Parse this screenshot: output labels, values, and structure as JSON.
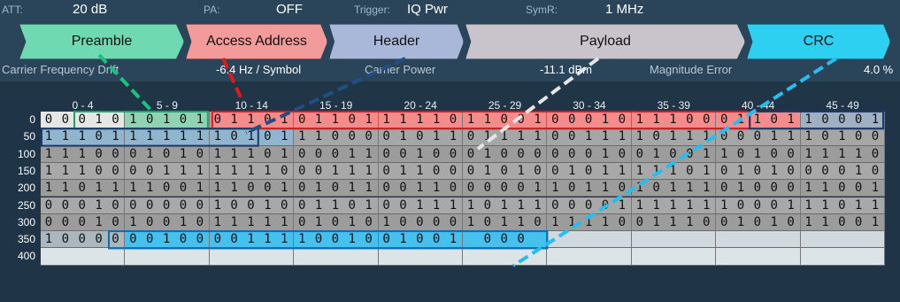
{
  "status_bar": {
    "att_label": "ATT:",
    "att_value": "20 dB",
    "pa_label": "PA:",
    "pa_value": "OFF",
    "trigger_label": "Trigger:",
    "trigger_value": "IQ Pwr",
    "symr_label": "SymR:",
    "symr_value": "1 MHz"
  },
  "fields": [
    {
      "label": "Preamble",
      "color": "#6fd9b2"
    },
    {
      "label": "Access Address",
      "color": "#f39a9a"
    },
    {
      "label": "Header",
      "color": "#a9b8d9"
    },
    {
      "label": "Payload",
      "color": "#c9c3cc"
    },
    {
      "label": "CRC",
      "color": "#2ed0f2"
    }
  ],
  "measurements": {
    "cfd_label": "Carrier Frequency Drift",
    "cfd_value": "-6.4 Hz / Symbol",
    "cp_label": "Carrier Power",
    "cp_value": "-11.1 dBm",
    "me_label": "Magnitude Error",
    "me_value": "4.0 %"
  },
  "column_headers": [
    "0 - 4",
    "5 - 9",
    "10 - 14",
    "15 - 19",
    "20 - 24",
    "25 - 29",
    "30 - 34",
    "35 - 39",
    "40 - 44",
    "45 - 49"
  ],
  "row_labels": [
    "0",
    "50",
    "100",
    "150",
    "200",
    "250",
    "300",
    "350",
    "400"
  ],
  "bit_rows": [
    [
      "0 0 0 1 0",
      "1 0 1 0 1",
      "0 1 1 0 1",
      "0 1 1 0 1",
      "1 1 1 1 0",
      "1 1 0 0 1",
      "0 0 0 1 0",
      "1 1 1 0 0",
      "0 1 1 0 1",
      "1 0 0 0 1"
    ],
    [
      "1 1 1 0 1",
      "1 1 1 1 1",
      "1 0 1 0 1",
      "1 1 0 0 0",
      "0 1 0 1 1",
      "0 1 1 1 1",
      "0 0 1 1 1",
      "1 0 1 1 1",
      "0 0 0 1 1",
      "1 0 1 0 0"
    ],
    [
      "1 1 1 0 0",
      "0 1 0 1 0",
      "1 1 1 0 1",
      "0 0 0 1 1",
      "0 0 1 0 0",
      "0 1 0 0 0",
      "0 0 0 1 0",
      "0 1 0 0 1",
      "1 0 1 0 0",
      "1 1 1 1 0"
    ],
    [
      "1 1 1 0 0",
      "0 0 1 1 1",
      "1 1 1 1 0",
      "0 0 1 1 1",
      "0 1 1 0 0",
      "0 1 0 1 0",
      "0 1 0 1 1",
      "1 1 1 0 1",
      "0 1 0 1 0",
      "0 0 0 1 0"
    ],
    [
      "1 1 0 1 1",
      "1 1 0 0 1",
      "1 1 0 0 1",
      "0 1 0 1 1",
      "0 0 1 1 0",
      "0 0 0 0 1",
      "1 0 1 1 0",
      "1 0 1 1 1",
      "0 1 0 0 0",
      "1 1 0 0 1"
    ],
    [
      "0 0 0 1 0",
      "0 0 0 0 0",
      "1 0 0 1 0",
      "0 1 1 0 1",
      "0 0 1 1 1",
      "1 0 1 1 1",
      "0 0 0 0 1",
      "1 1 1 1 1",
      "1 0 0 0 1",
      "1 1 0 1 1"
    ],
    [
      "0 0 0 1 0",
      "1 0 0 1 0",
      "1 1 1 1 1",
      "0 1 0 1 0",
      "1 0 0 0 0",
      "1 0 1 1 0",
      "1 1 1 1 0",
      "0 1 1 1 0",
      "0 1 0 1 0",
      "1 1 0 0 1"
    ],
    [
      "1 0 0 0 0",
      "0 0 1 0 0",
      "0 0 1 1 1",
      "1 0 0 1 0",
      "0 1 0 0 1",
      "0 0 0",
      "",
      "",
      "",
      ""
    ],
    [
      "",
      "",
      "",
      "",
      "",
      "",
      "",
      "",
      "",
      ""
    ]
  ]
}
